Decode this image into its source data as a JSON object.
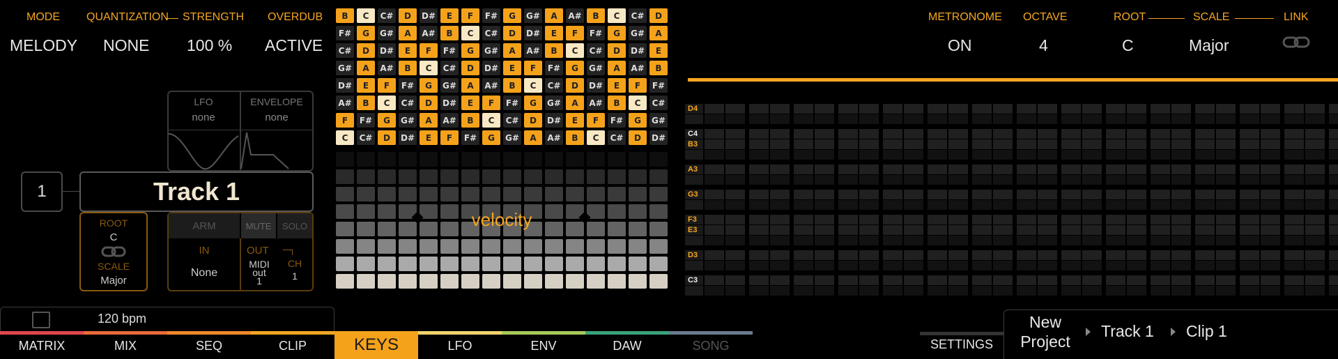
{
  "top_left": {
    "mode": {
      "label": "MODE",
      "value": "MELODY"
    },
    "quantization": {
      "label": "QUANTIZATION",
      "value": "NONE"
    },
    "strength": {
      "label": "STRENGTH",
      "value": "100 %"
    },
    "overdub": {
      "label": "OVERDUB",
      "value": "ACTIVE"
    }
  },
  "track_panel": {
    "number": "1",
    "name": "Track 1",
    "lfo": {
      "label": "LFO",
      "value": "none"
    },
    "envelope": {
      "label": "ENVELOPE",
      "value": "none"
    },
    "root": {
      "label": "ROOT",
      "value": "C"
    },
    "scale": {
      "label": "SCALE",
      "value": "Major"
    },
    "arm": "ARM",
    "mute": "MUTE",
    "solo": "SOLO",
    "in": {
      "label": "IN",
      "value": "None"
    },
    "out": {
      "label": "OUT",
      "value_line1": "MIDI",
      "value_line2": "out",
      "value_line3": "1"
    },
    "ch": {
      "label": "CH",
      "value": "1"
    }
  },
  "keys_grid": {
    "rows": [
      [
        "B",
        "C",
        "C#",
        "D",
        "D#",
        "E",
        "F",
        "F#",
        "G",
        "G#",
        "A",
        "A#",
        "B",
        "C",
        "C#",
        "D"
      ],
      [
        "F#",
        "G",
        "G#",
        "A",
        "A#",
        "B",
        "C",
        "C#",
        "D",
        "D#",
        "E",
        "F",
        "F#",
        "G",
        "G#",
        "A"
      ],
      [
        "C#",
        "D",
        "D#",
        "E",
        "F",
        "F#",
        "G",
        "G#",
        "A",
        "A#",
        "B",
        "C",
        "C#",
        "D",
        "D#",
        "E"
      ],
      [
        "G#",
        "A",
        "A#",
        "B",
        "C",
        "C#",
        "D",
        "D#",
        "E",
        "F",
        "F#",
        "G",
        "G#",
        "A",
        "A#",
        "B"
      ],
      [
        "D#",
        "E",
        "F",
        "F#",
        "G",
        "G#",
        "A",
        "A#",
        "B",
        "C",
        "C#",
        "D",
        "D#",
        "E",
        "F",
        "F#"
      ],
      [
        "A#",
        "B",
        "C",
        "C#",
        "D",
        "D#",
        "E",
        "F",
        "F#",
        "G",
        "G#",
        "A",
        "A#",
        "B",
        "C",
        "C#"
      ],
      [
        "F",
        "F#",
        "G",
        "G#",
        "A",
        "A#",
        "B",
        "C",
        "C#",
        "D",
        "D#",
        "E",
        "F",
        "F#",
        "G",
        "G#"
      ],
      [
        "C",
        "C#",
        "D",
        "D#",
        "E",
        "F",
        "F#",
        "G",
        "G#",
        "A",
        "A#",
        "B",
        "C",
        "C#",
        "D",
        "D#"
      ]
    ],
    "scale_notes": [
      "C",
      "D",
      "E",
      "F",
      "G",
      "A",
      "B"
    ],
    "root_note": "C",
    "colors": {
      "root": "#f8e8c4",
      "scale": "#f5a21b",
      "off": "#232323"
    }
  },
  "velocity": {
    "label": "velocity"
  },
  "status": {
    "bpm": "120 bpm"
  },
  "nav": {
    "tabs": [
      {
        "label": "MATRIX",
        "color": "#e0474c"
      },
      {
        "label": "MIX",
        "color": "#e86a3a"
      },
      {
        "label": "SEQ",
        "color": "#f0882a"
      },
      {
        "label": "CLIP",
        "color": "#f5a623"
      },
      {
        "label": "KEYS",
        "color": "#f5a21b"
      },
      {
        "label": "LFO",
        "color": "#f2d36b"
      },
      {
        "label": "ENV",
        "color": "#a8c95a"
      },
      {
        "label": "DAW",
        "color": "#3aa27a"
      },
      {
        "label": "SONG",
        "color": "#6a7b8c"
      }
    ],
    "active": "KEYS"
  },
  "top_right": {
    "metronome": {
      "label": "METRONOME",
      "value": "ON"
    },
    "octave": {
      "label": "OCTAVE",
      "value": "4"
    },
    "root": {
      "label": "ROOT",
      "value": "C"
    },
    "scale": {
      "label": "SCALE",
      "value": "Major"
    },
    "link": {
      "label": "LINK",
      "icon": "link-icon"
    }
  },
  "piano_roll": {
    "rows": [
      {
        "note": "D4",
        "white": false
      },
      {
        "note": "C4",
        "white": true
      },
      {
        "note": "B3",
        "white": false
      },
      {
        "note": "A3",
        "white": false
      },
      {
        "note": "G3",
        "white": false
      },
      {
        "note": "F3",
        "white": false
      },
      {
        "note": "E3",
        "white": false
      },
      {
        "note": "D3",
        "white": false
      },
      {
        "note": "C3",
        "white": true
      }
    ]
  },
  "breadcrumb": {
    "settings": "SETTINGS",
    "project_line1": "New",
    "project_line2": "Project",
    "track": "Track 1",
    "clip": "Clip 1"
  },
  "accent": "#f5a623"
}
